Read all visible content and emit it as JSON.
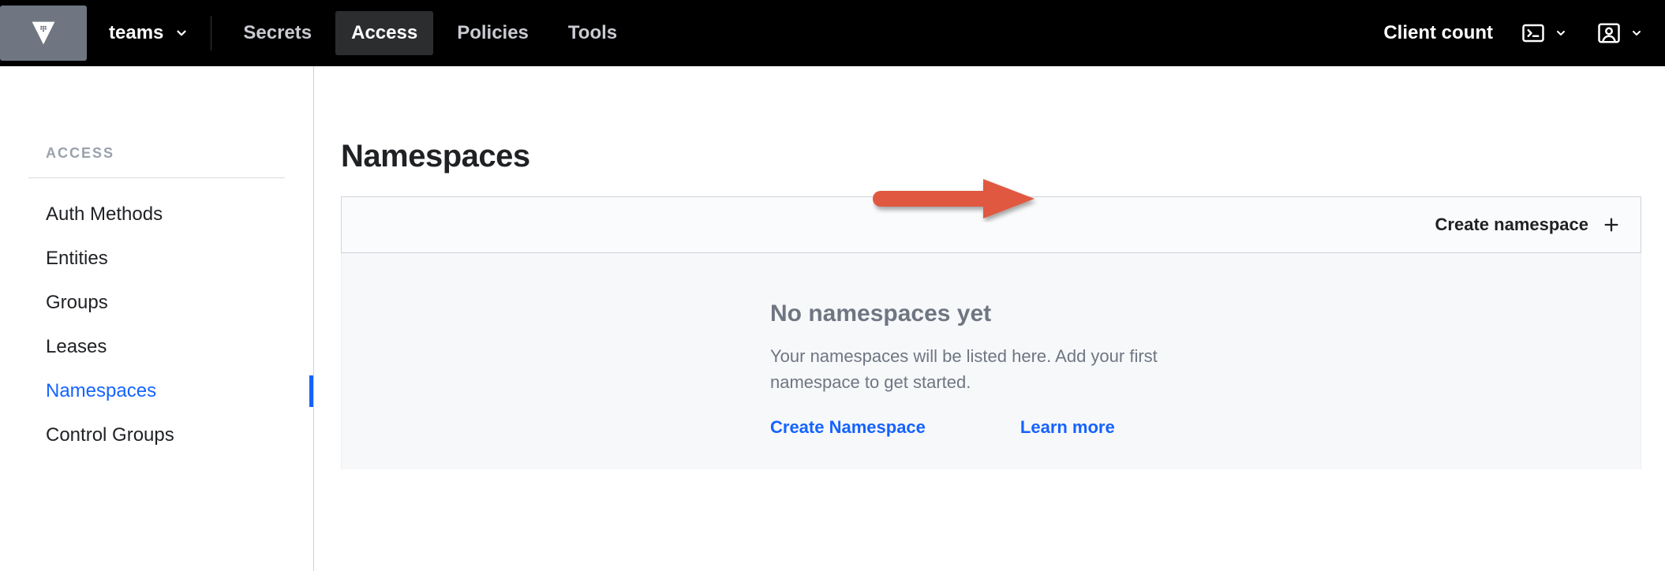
{
  "header": {
    "team_label": "teams",
    "nav": [
      {
        "label": "Secrets",
        "active": false
      },
      {
        "label": "Access",
        "active": true
      },
      {
        "label": "Policies",
        "active": false
      },
      {
        "label": "Tools",
        "active": false
      }
    ],
    "client_count_label": "Client count"
  },
  "sidebar": {
    "heading": "ACCESS",
    "items": [
      {
        "label": "Auth Methods",
        "active": false
      },
      {
        "label": "Entities",
        "active": false
      },
      {
        "label": "Groups",
        "active": false
      },
      {
        "label": "Leases",
        "active": false
      },
      {
        "label": "Namespaces",
        "active": true
      },
      {
        "label": "Control Groups",
        "active": false
      }
    ]
  },
  "main": {
    "title": "Namespaces",
    "create_button_label": "Create namespace",
    "empty_state": {
      "title": "No namespaces yet",
      "description": "Your namespaces will be listed here. Add your first namespace to get started.",
      "create_link": "Create Namespace",
      "learn_link": "Learn more"
    }
  }
}
